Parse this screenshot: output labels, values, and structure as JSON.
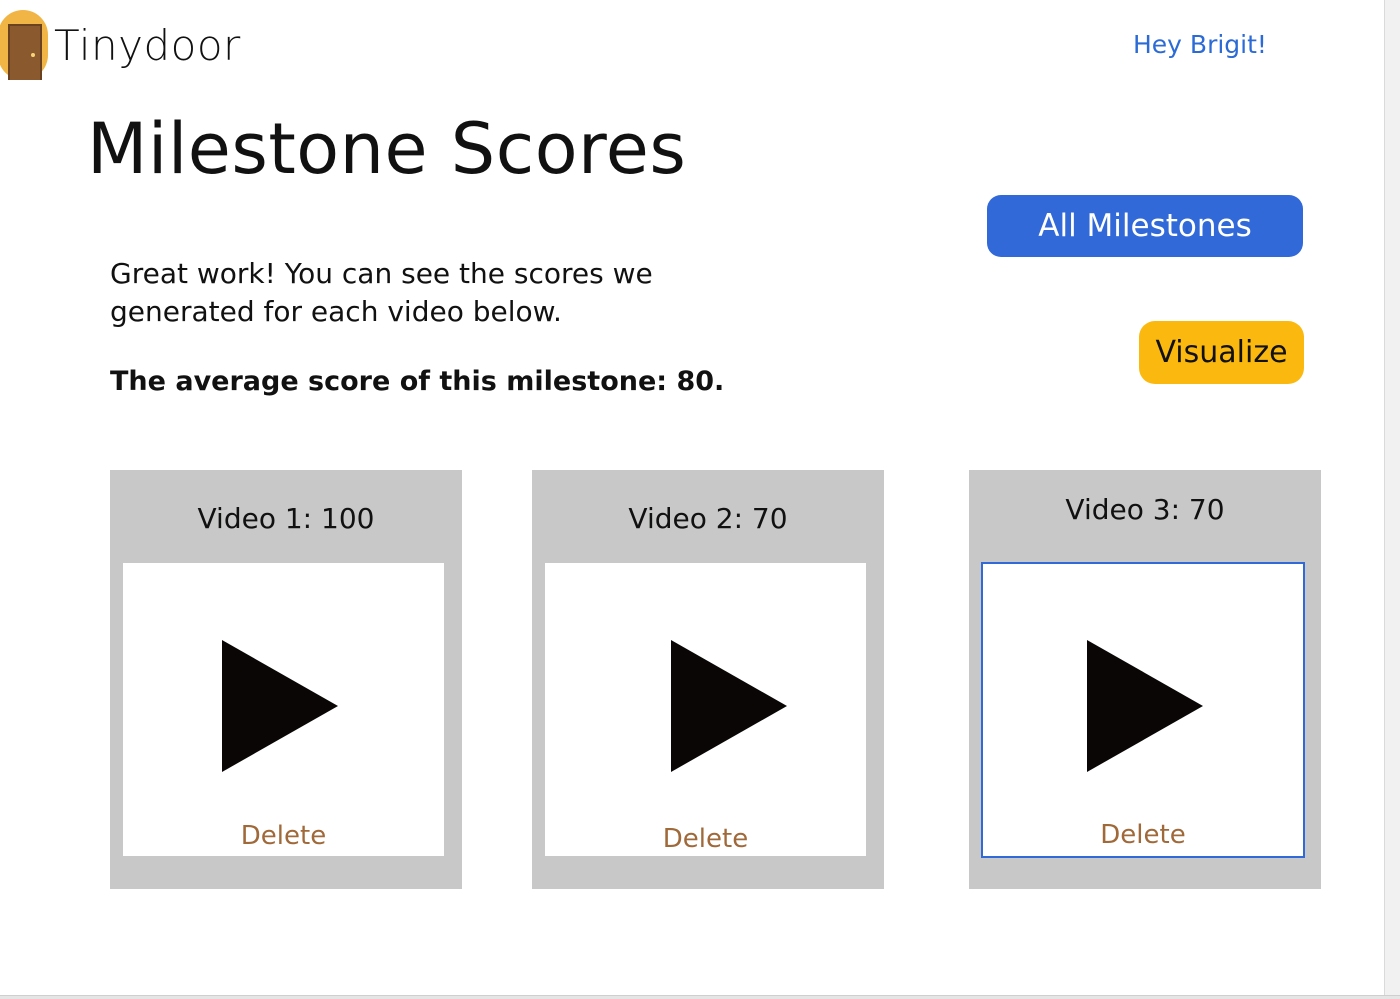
{
  "header": {
    "logo_text": "Tinydoor",
    "logo_icon": "door-icon",
    "greeting": "Hey Brigit!"
  },
  "page": {
    "title": "Milestone Scores",
    "intro": "Great work! You can see the scores we generated for each video below.",
    "average_text": "The average score of this milestone: 80."
  },
  "actions": {
    "all_milestones_label": "All Milestones",
    "visualize_label": "Visualize"
  },
  "videos": [
    {
      "title": "Video 1: 100",
      "delete_label": "Delete",
      "icon": "play-icon"
    },
    {
      "title": "Video 2: 70",
      "delete_label": "Delete",
      "icon": "play-icon"
    },
    {
      "title": "Video 3: 70",
      "delete_label": "Delete",
      "icon": "play-icon"
    }
  ],
  "colors": {
    "accent_blue": "#3169d8",
    "accent_yellow": "#fbb80f",
    "card_gray": "#c7c8c7",
    "delete_brown": "#a0693a",
    "greeting_blue": "#2c6bd6"
  }
}
